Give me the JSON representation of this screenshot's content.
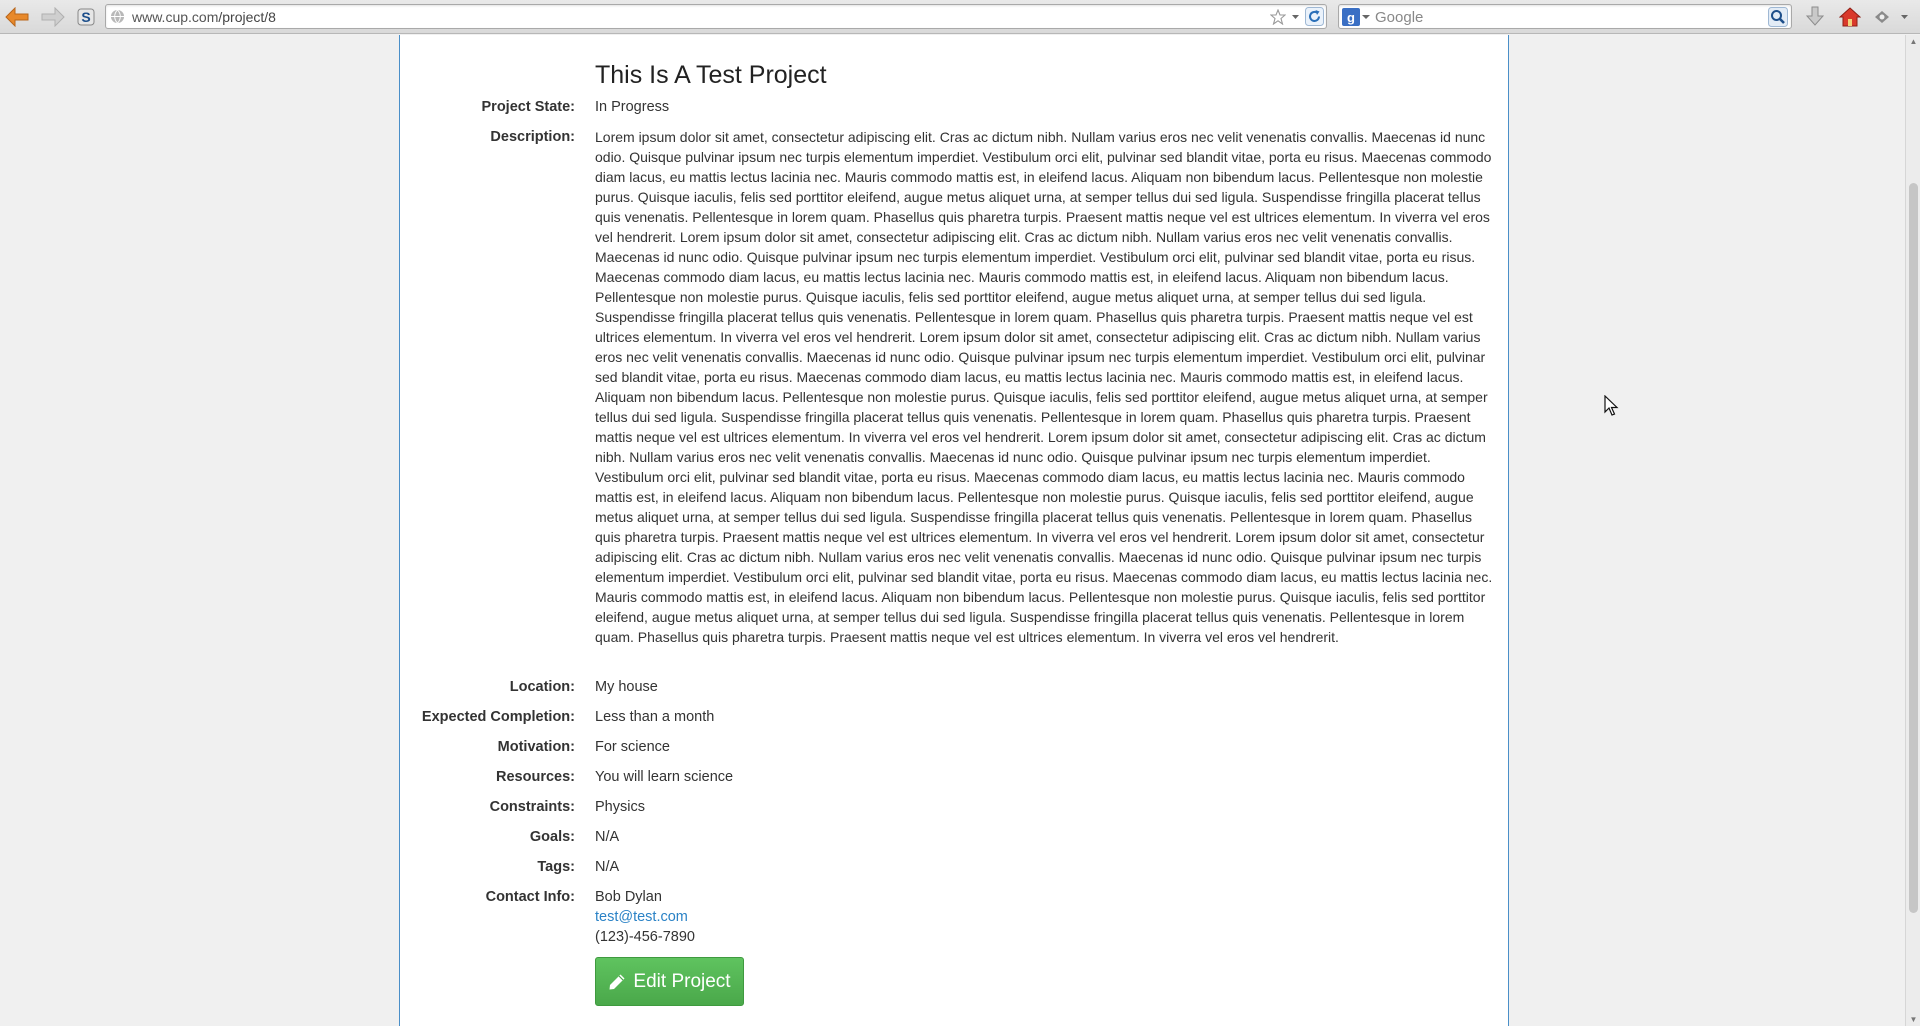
{
  "browser": {
    "url_host": "www.cup.com",
    "url_path": "/project/8",
    "search_placeholder": "Google",
    "icons": {
      "back": "back-arrow-icon",
      "forward": "forward-arrow-icon",
      "stylish": "stylish-icon",
      "globe": "globe-icon",
      "bookmark": "star-icon",
      "history": "dropdown-arrow-icon",
      "reload": "reload-icon",
      "engine": "google-icon",
      "search": "magnifier-icon",
      "downloads": "download-icon",
      "home": "home-icon",
      "addon": "addon-icon",
      "menu": "menu-arrow-icon"
    }
  },
  "project": {
    "title": "This Is A Test Project",
    "fields": {
      "state": {
        "label": "Project State:",
        "value": "In Progress"
      },
      "description": {
        "label": "Description:",
        "value": "Lorem ipsum dolor sit amet, consectetur adipiscing elit. Cras ac dictum nibh. Nullam varius eros nec velit venenatis convallis. Maecenas id nunc odio. Quisque pulvinar ipsum nec turpis elementum imperdiet. Vestibulum orci elit, pulvinar sed blandit vitae, porta eu risus. Maecenas commodo diam lacus, eu mattis lectus lacinia nec. Mauris commodo mattis est, in eleifend lacus. Aliquam non bibendum lacus. Pellentesque non molestie purus. Quisque iaculis, felis sed porttitor eleifend, augue metus aliquet urna, at semper tellus dui sed ligula. Suspendisse fringilla placerat tellus quis venenatis. Pellentesque in lorem quam. Phasellus quis pharetra turpis. Praesent mattis neque vel est ultrices elementum. In viverra vel eros vel hendrerit. Lorem ipsum dolor sit amet, consectetur adipiscing elit. Cras ac dictum nibh. Nullam varius eros nec velit venenatis convallis. Maecenas id nunc odio. Quisque pulvinar ipsum nec turpis elementum imperdiet. Vestibulum orci elit, pulvinar sed blandit vitae, porta eu risus. Maecenas commodo diam lacus, eu mattis lectus lacinia nec. Mauris commodo mattis est, in eleifend lacus. Aliquam non bibendum lacus. Pellentesque non molestie purus. Quisque iaculis, felis sed porttitor eleifend, augue metus aliquet urna, at semper tellus dui sed ligula. Suspendisse fringilla placerat tellus quis venenatis. Pellentesque in lorem quam. Phasellus quis pharetra turpis. Praesent mattis neque vel est ultrices elementum. In viverra vel eros vel hendrerit. Lorem ipsum dolor sit amet, consectetur adipiscing elit. Cras ac dictum nibh. Nullam varius eros nec velit venenatis convallis. Maecenas id nunc odio. Quisque pulvinar ipsum nec turpis elementum imperdiet. Vestibulum orci elit, pulvinar sed blandit vitae, porta eu risus. Maecenas commodo diam lacus, eu mattis lectus lacinia nec. Mauris commodo mattis est, in eleifend lacus. Aliquam non bibendum lacus. Pellentesque non molestie purus. Quisque iaculis, felis sed porttitor eleifend, augue metus aliquet urna, at semper tellus dui sed ligula. Suspendisse fringilla placerat tellus quis venenatis. Pellentesque in lorem quam. Phasellus quis pharetra turpis. Praesent mattis neque vel est ultrices elementum. In viverra vel eros vel hendrerit. Lorem ipsum dolor sit amet, consectetur adipiscing elit. Cras ac dictum nibh. Nullam varius eros nec velit venenatis convallis. Maecenas id nunc odio. Quisque pulvinar ipsum nec turpis elementum imperdiet. Vestibulum orci elit, pulvinar sed blandit vitae, porta eu risus. Maecenas commodo diam lacus, eu mattis lectus lacinia nec. Mauris commodo mattis est, in eleifend lacus. Aliquam non bibendum lacus. Pellentesque non molestie purus. Quisque iaculis, felis sed porttitor eleifend, augue metus aliquet urna, at semper tellus dui sed ligula. Suspendisse fringilla placerat tellus quis venenatis. Pellentesque in lorem quam. Phasellus quis pharetra turpis. Praesent mattis neque vel est ultrices elementum. In viverra vel eros vel hendrerit. Lorem ipsum dolor sit amet, consectetur adipiscing elit. Cras ac dictum nibh. Nullam varius eros nec velit venenatis convallis. Maecenas id nunc odio. Quisque pulvinar ipsum nec turpis elementum imperdiet. Vestibulum orci elit, pulvinar sed blandit vitae, porta eu risus. Maecenas commodo diam lacus, eu mattis lectus lacinia nec. Mauris commodo mattis est, in eleifend lacus. Aliquam non bibendum lacus. Pellentesque non molestie purus. Quisque iaculis, felis sed porttitor eleifend, augue metus aliquet urna, at semper tellus dui sed ligula. Suspendisse fringilla placerat tellus quis venenatis. Pellentesque in lorem quam. Phasellus quis pharetra turpis. Praesent mattis neque vel est ultrices elementum. In viverra vel eros vel hendrerit."
      },
      "location": {
        "label": "Location:",
        "value": "My house"
      },
      "completion": {
        "label": "Expected Completion:",
        "value": "Less than a month"
      },
      "motivation": {
        "label": "Motivation:",
        "value": "For science"
      },
      "resources": {
        "label": "Resources:",
        "value": "You will learn science"
      },
      "constraints": {
        "label": "Constraints:",
        "value": "Physics"
      },
      "goals": {
        "label": "Goals:",
        "value": "N/A"
      },
      "tags": {
        "label": "Tags:",
        "value": "N/A"
      },
      "contact": {
        "label": "Contact Info:",
        "name": "Bob Dylan",
        "email": "test@test.com",
        "phone": "(123)-456-7890"
      }
    },
    "edit_button": {
      "label": "Edit Project",
      "icon": "pencil-icon"
    }
  },
  "colors": {
    "card_border": "#4a8fc8",
    "link": "#2a82c6",
    "button_green": "#52b352",
    "page_bg": "#f0f0f0"
  }
}
